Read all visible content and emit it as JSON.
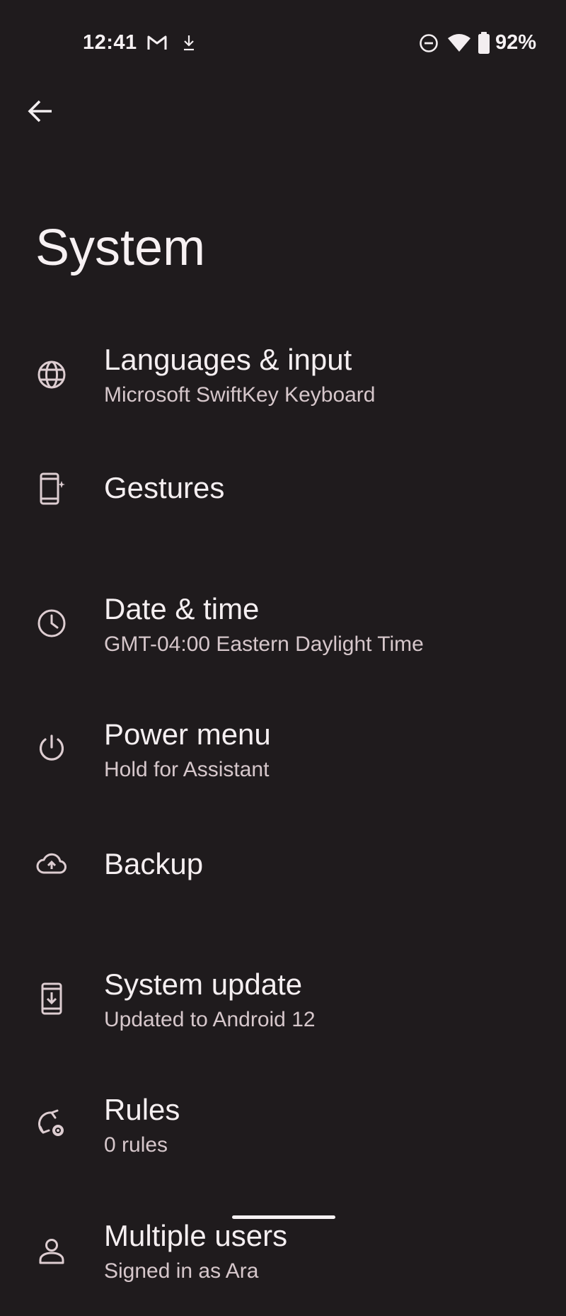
{
  "status_bar": {
    "time": "12:41",
    "battery_percent": "92%",
    "notification_icons": [
      "gmail-icon",
      "download-icon"
    ],
    "system_icons": [
      "do-not-disturb-icon",
      "wifi-icon",
      "battery-icon"
    ]
  },
  "header": {
    "back_icon": "arrow-back-icon",
    "title": "System"
  },
  "settings": [
    {
      "icon": "globe-icon",
      "title": "Languages & input",
      "summary": "Microsoft SwiftKey Keyboard"
    },
    {
      "icon": "phone-sparkle-icon",
      "title": "Gestures",
      "summary": ""
    },
    {
      "icon": "clock-icon",
      "title": "Date & time",
      "summary": "GMT-04:00 Eastern Daylight Time"
    },
    {
      "icon": "power-icon",
      "title": "Power menu",
      "summary": "Hold for Assistant"
    },
    {
      "icon": "cloud-upload-icon",
      "title": "Backup",
      "summary": ""
    },
    {
      "icon": "system-update-icon",
      "title": "System update",
      "summary": "Updated to Android 12"
    },
    {
      "icon": "rules-icon",
      "title": "Rules",
      "summary": "0 rules"
    },
    {
      "icon": "person-icon",
      "title": "Multiple users",
      "summary": "Signed in as Ara"
    }
  ],
  "colors": {
    "background": "#1f1b1d",
    "title_text": "#f5eff1",
    "summary_text": "#d6c7cb",
    "icon": "#ddcdd1"
  }
}
